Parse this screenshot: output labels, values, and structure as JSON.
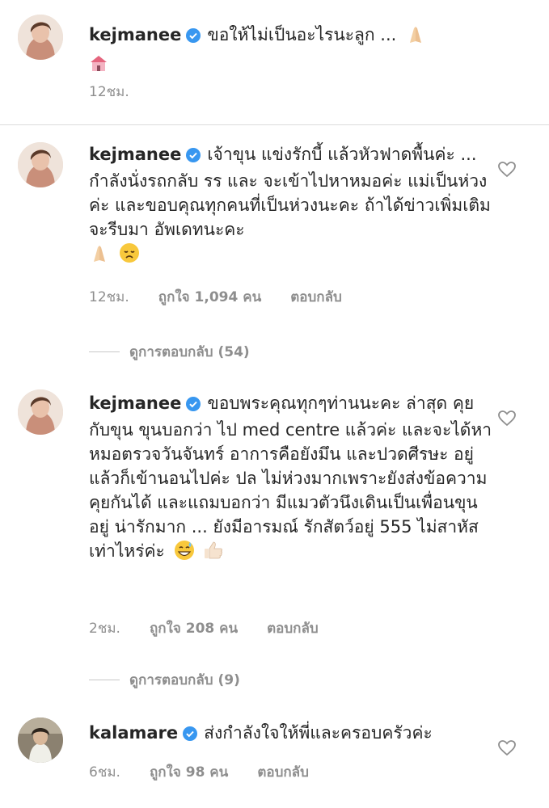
{
  "comments": [
    {
      "username": "kejmanee",
      "verified": true,
      "text": "ขอให้ไม่เป็นอะไรนะลูก ...",
      "emojis": [
        "folded-hands",
        "church"
      ],
      "time": "12ชม.",
      "likes": "",
      "reply": ""
    },
    {
      "username": "kejmanee",
      "verified": true,
      "text": "เจ้าขุน แข่งรักบี้ แล้วหัวฟาดพื้นค่ะ ... กำลังนั่งรถกลับ รร และ จะเข้าไปหาหมอค่ะ แม่เป็นห่วงค่ะ และขอบคุณทุกคนที่เป็นห่วงนะคะ ถ้าได้ข่าวเพิ่มเติมจะรีบมา อัพเดทนะคะ",
      "emojis": [
        "folded-hands",
        "disappointed-face"
      ],
      "time": "12ชม.",
      "likes": "ถูกใจ 1,094 คน",
      "reply": "ตอบกลับ",
      "view_replies": "ดูการตอบกลับ (54)"
    },
    {
      "username": "kejmanee",
      "verified": true,
      "text": "ขอบพระคุณทุกๆท่านนะคะ ล่าสุด คุยกับขุน ขุนบอกว่า ไป med centre แล้วค่ะ และจะได้หาหมอตรวจวันจันทร์ อาการคือยังมึน และปวดศีรษะ อยู่ แล้วก็เข้านอนไปค่ะ ปล ไม่ห่วงมากเพราะยังส่งข้อความคุยกันได้ และแถมบอกว่า มีแมวตัวนึงเดินเป็นเพื่อนขุนอยู่ น่ารักมาก ... ยังมีอารมณ์ รักสัตว์อยู่ 555 ไม่สาหัสเท่าไหร่ค่ะ",
      "emojis": [
        "grinning-sweat-face",
        "thumbs-up"
      ],
      "time": "2ชม.",
      "likes": "ถูกใจ 208 คน",
      "reply": "ตอบกลับ",
      "view_replies": "ดูการตอบกลับ (9)"
    },
    {
      "username": "kalamare",
      "verified": true,
      "text": "ส่งกำลังใจให้พี่และครอบครัวค่ะ",
      "emojis": [],
      "time": "6ชม.",
      "likes": "ถูกใจ 98 คน",
      "reply": "ตอบกลับ"
    }
  ],
  "colors": {
    "text": "#262626",
    "meta": "#8e8e8e",
    "verified": "#3897f0",
    "divider": "#dbdbdb"
  }
}
